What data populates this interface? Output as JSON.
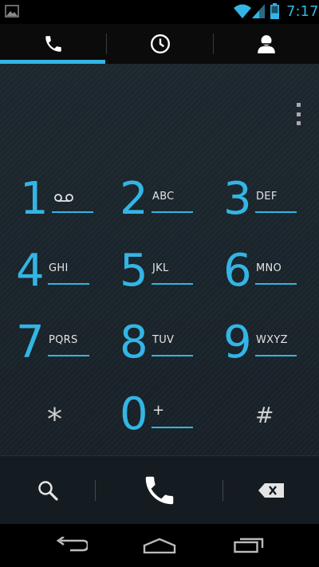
{
  "status_bar": {
    "time": "7:17",
    "icons": [
      "image-notification-icon",
      "wifi-icon",
      "signal-icon",
      "battery-icon"
    ]
  },
  "tabs": [
    {
      "name": "dialer",
      "icon": "phone-icon",
      "selected": true
    },
    {
      "name": "call-log",
      "icon": "clock-icon",
      "selected": false
    },
    {
      "name": "contacts",
      "icon": "person-icon",
      "selected": false
    }
  ],
  "keypad": {
    "keys": [
      {
        "digit": "1",
        "letters": "",
        "icon": "voicemail-icon"
      },
      {
        "digit": "2",
        "letters": "ABC"
      },
      {
        "digit": "3",
        "letters": "DEF"
      },
      {
        "digit": "4",
        "letters": "GHI"
      },
      {
        "digit": "5",
        "letters": "JKL"
      },
      {
        "digit": "6",
        "letters": "MNO"
      },
      {
        "digit": "7",
        "letters": "PQRS"
      },
      {
        "digit": "8",
        "letters": "TUV"
      },
      {
        "digit": "9",
        "letters": "WXYZ"
      },
      {
        "digit": "*",
        "letters": ""
      },
      {
        "digit": "0",
        "letters": "+"
      },
      {
        "digit": "#",
        "letters": ""
      }
    ]
  },
  "actions": [
    "search-icon",
    "call-icon",
    "backspace-icon"
  ],
  "nav": [
    "back-icon",
    "home-icon",
    "recent-apps-icon"
  ],
  "colors": {
    "accent": "#33b5e5",
    "background": "#1b252c",
    "tab_bar": "#0b0b0b",
    "action_bar": "#151c21",
    "letters": "#e4e4e4"
  }
}
